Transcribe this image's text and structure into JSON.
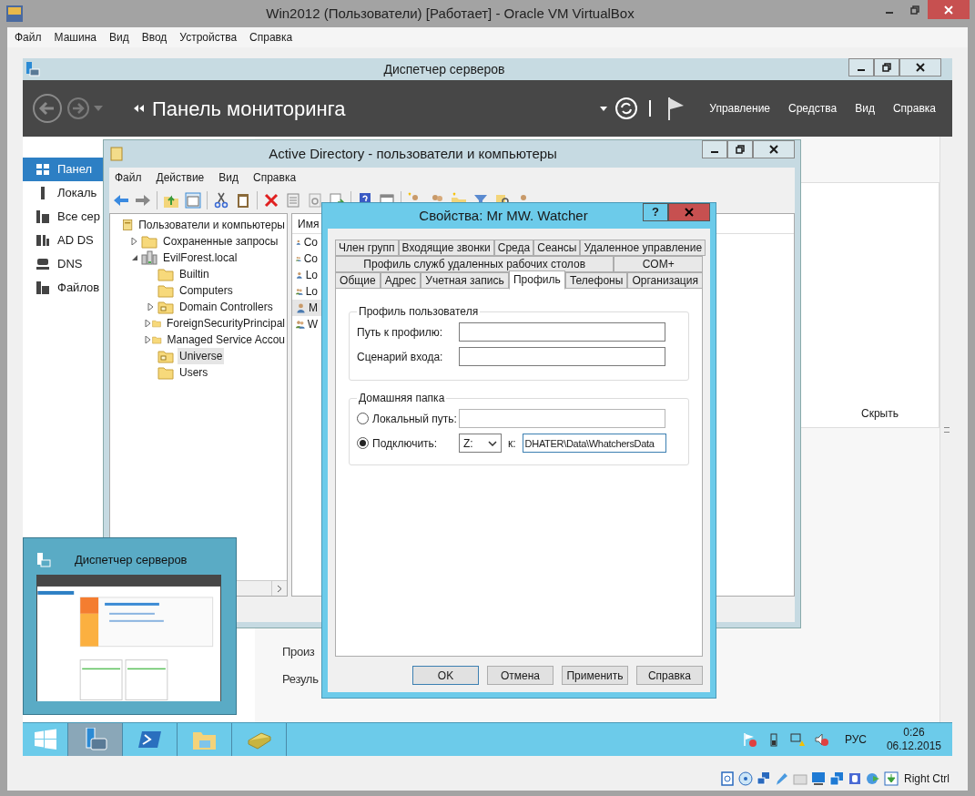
{
  "vbox": {
    "title": "Win2012 (Пользователи) [Работает] - Oracle VM VirtualBox",
    "menu": [
      "Файл",
      "Машина",
      "Вид",
      "Ввод",
      "Устройства",
      "Справка"
    ],
    "host_key": "Right Ctrl"
  },
  "server_manager": {
    "title": "Диспетчер серверов",
    "heading": "Панель мониторинга",
    "menu": [
      "Управление",
      "Средства",
      "Вид",
      "Справка"
    ],
    "sidebar": [
      {
        "label": "Панел",
        "kind": "dashboard",
        "selected": true
      },
      {
        "label": "Локаль",
        "kind": "server",
        "selected": false
      },
      {
        "label": "Все сер",
        "kind": "servers",
        "selected": false
      },
      {
        "label": "AD DS",
        "kind": "ad",
        "selected": false
      },
      {
        "label": "DNS",
        "kind": "dns",
        "selected": false
      },
      {
        "label": "Файлов",
        "kind": "files",
        "selected": false
      }
    ],
    "hide_link": "Скрыть",
    "texts": [
      "Произ",
      "Резуль"
    ]
  },
  "ad_window": {
    "title": "Active Directory - пользователи и компьютеры",
    "menu": [
      "Файл",
      "Действие",
      "Вид",
      "Справка"
    ],
    "tree": [
      {
        "label": "Пользователи и компьютеры",
        "kind": "console",
        "selected": false,
        "children": [
          {
            "label": "Сохраненные запросы",
            "kind": "folder",
            "expanded": false,
            "selected": false
          },
          {
            "label": "EvilForest.local",
            "kind": "domain",
            "expanded": true,
            "selected": false,
            "children": [
              {
                "label": "Builtin",
                "kind": "folder",
                "selected": false
              },
              {
                "label": "Computers",
                "kind": "folder",
                "selected": false
              },
              {
                "label": "Domain Controllers",
                "kind": "ou",
                "expanded": false,
                "selected": false
              },
              {
                "label": "ForeignSecurityPrincipal",
                "kind": "folder",
                "expanded": false,
                "selected": false
              },
              {
                "label": "Managed Service Accou",
                "kind": "folder",
                "expanded": false,
                "selected": false
              },
              {
                "label": "Universe",
                "kind": "ou",
                "selected": true
              },
              {
                "label": "Users",
                "kind": "folder",
                "selected": false
              }
            ]
          }
        ]
      }
    ],
    "list": {
      "column": "Имя",
      "rows": [
        {
          "name": "Co",
          "kind": "user",
          "selected": false
        },
        {
          "name": "Co",
          "kind": "group",
          "selected": false
        },
        {
          "name": "Lo",
          "kind": "user",
          "selected": false
        },
        {
          "name": "Lo",
          "kind": "group",
          "selected": false
        },
        {
          "name": "M",
          "kind": "user",
          "selected": true
        },
        {
          "name": "W",
          "kind": "group",
          "selected": false
        }
      ]
    }
  },
  "dialog": {
    "title": "Свойства: Mr MW. Watcher",
    "help": "?",
    "tab_rows": [
      [
        {
          "label": "Член групп",
          "selected": false
        },
        {
          "label": "Входящие звонки",
          "selected": false
        },
        {
          "label": "Среда",
          "selected": false
        },
        {
          "label": "Сеансы",
          "selected": false
        },
        {
          "label": "Удаленное управление",
          "selected": false
        }
      ],
      [
        {
          "label": "Профиль служб удаленных рабочих столов",
          "selected": false
        },
        {
          "label": "COM+",
          "selected": false
        }
      ],
      [
        {
          "label": "Общие",
          "selected": false
        },
        {
          "label": "Адрес",
          "selected": false
        },
        {
          "label": "Учетная запись",
          "selected": false
        },
        {
          "label": "Профиль",
          "selected": true
        },
        {
          "label": "Телефоны",
          "selected": false
        },
        {
          "label": "Организация",
          "selected": false
        }
      ]
    ],
    "profile_group": {
      "legend": "Профиль пользователя",
      "fields": [
        {
          "label": "Путь к профилю:"
        },
        {
          "label": "Сценарий входа:"
        }
      ]
    },
    "home_group": {
      "legend": "Домашняя папка",
      "options": [
        {
          "label": "Локальный путь:",
          "kind": "path",
          "selected": false
        },
        {
          "label": "Подключить:",
          "kind": "drive",
          "selected": true,
          "drive": "Z:",
          "connector": "к:",
          "value": "DHATER\\Data\\WhatchersData"
        }
      ]
    },
    "buttons": [
      {
        "label": "OK",
        "default": true
      },
      {
        "label": "Отмена",
        "default": false
      },
      {
        "label": "Применить",
        "default": false
      },
      {
        "label": "Справка",
        "default": false
      }
    ]
  },
  "thumbnail": {
    "title": "Диспетчер серверов"
  },
  "taskbar": {
    "apps": [
      {
        "kind": "start",
        "selected": false
      },
      {
        "kind": "server-manager",
        "selected": true
      },
      {
        "kind": "powershell",
        "selected": false
      },
      {
        "kind": "explorer",
        "selected": false
      },
      {
        "kind": "ad-tools",
        "selected": false
      }
    ],
    "lang": "РУС",
    "time": "0:26",
    "date": "06.12.2015"
  }
}
